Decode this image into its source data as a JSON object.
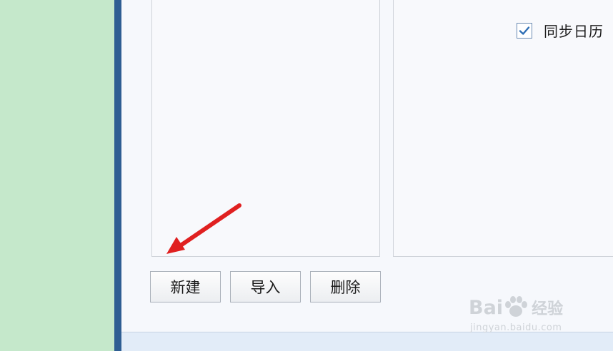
{
  "settings": {
    "sync_calendar_label": "同步日历",
    "sync_calendar_checked": true
  },
  "buttons": {
    "new_label": "新建",
    "import_label": "导入",
    "delete_label": "删除"
  },
  "watermark": {
    "brand_text": "Bai",
    "brand_suffix": "经验",
    "url_text": "jingyan.baidu.com"
  },
  "colors": {
    "desktop_bg": "#c5e8cb",
    "window_border": "#2f5e93",
    "arrow": "#e02020",
    "checkbox_check": "#2f6fb5"
  },
  "icons": {
    "arrow": "red-arrow-icon",
    "check": "checkmark-icon",
    "paw": "paw-icon"
  }
}
